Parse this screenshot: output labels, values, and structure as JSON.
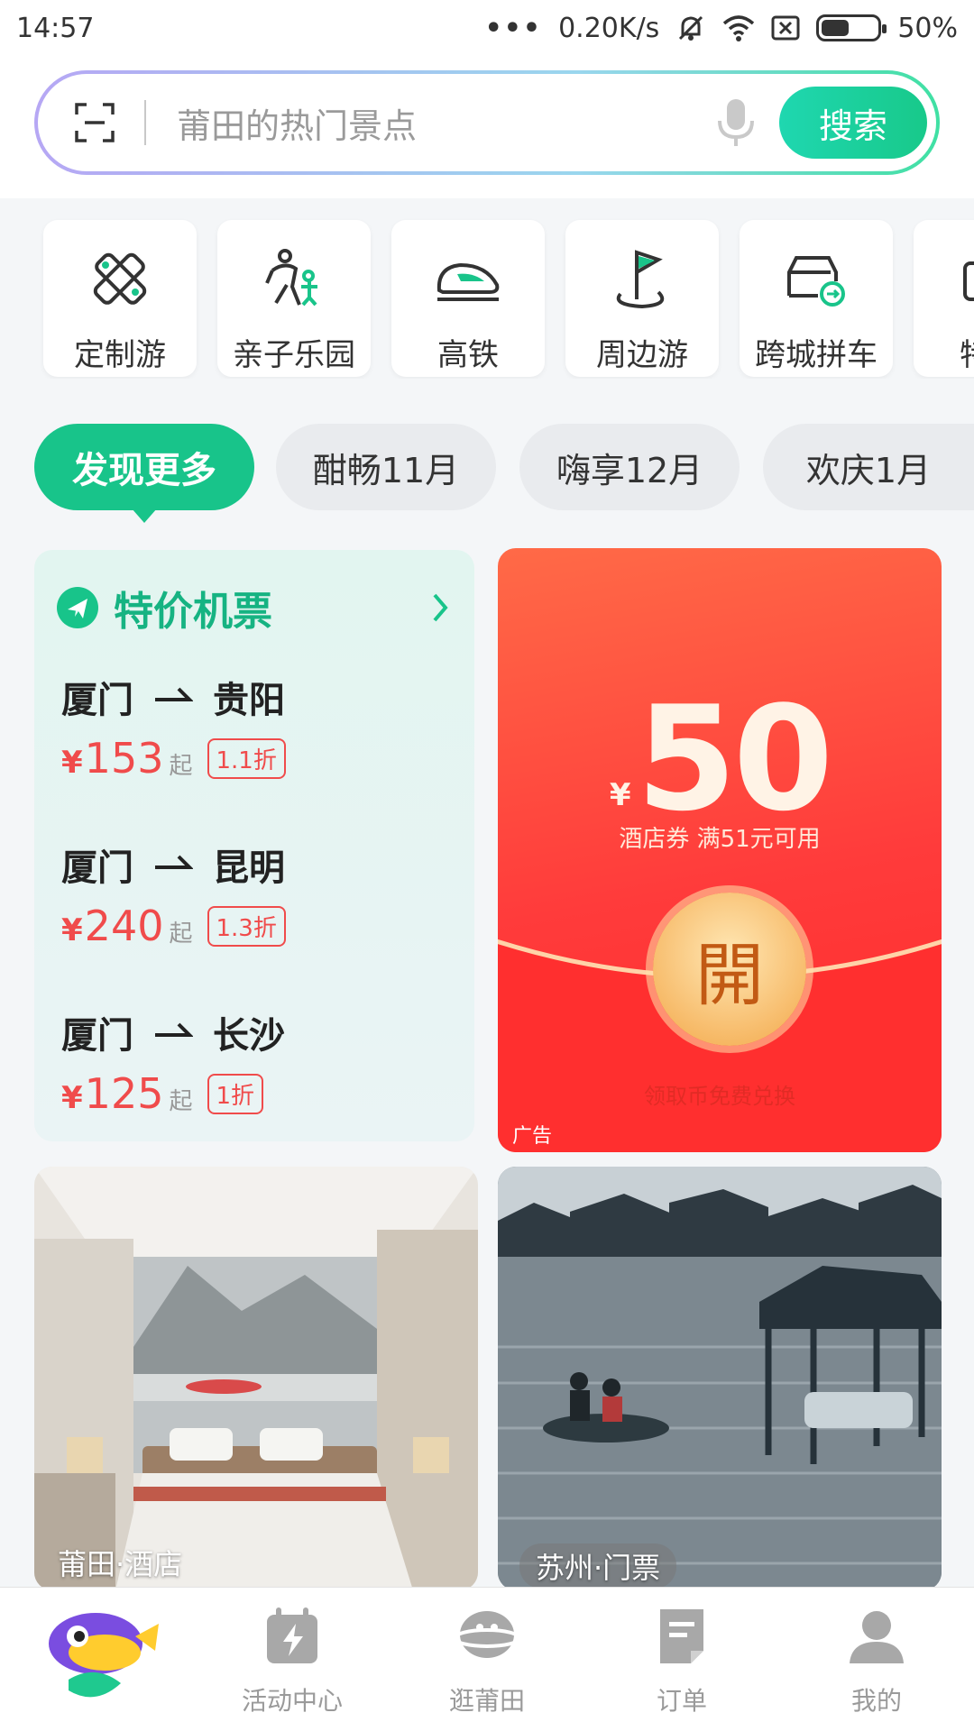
{
  "status_bar": {
    "time": "14:57",
    "dots": "•••",
    "speed": "0.20K/s",
    "battery": "50%",
    "battery_level": 0.5
  },
  "search": {
    "placeholder": "莆田的热门景点",
    "button": "搜索"
  },
  "categories": [
    {
      "label": "定制游",
      "icon": "custom-tour-icon"
    },
    {
      "label": "亲子乐园",
      "icon": "family-park-icon"
    },
    {
      "label": "高铁",
      "icon": "train-icon"
    },
    {
      "label": "周边游",
      "icon": "nearby-trip-icon"
    },
    {
      "label": "跨城拼车",
      "icon": "carpool-icon"
    },
    {
      "label": "特价",
      "icon": "special-offer-icon"
    }
  ],
  "pills": [
    "发现更多",
    "酣畅11月",
    "嗨享12月",
    "欢庆1月"
  ],
  "flights": {
    "title": "特价机票",
    "routes": [
      {
        "from": "厦门",
        "to": "贵阳",
        "price": "153",
        "qi": "起",
        "discount": "1.1折"
      },
      {
        "from": "厦门",
        "to": "昆明",
        "price": "240",
        "qi": "起",
        "discount": "1.3折"
      },
      {
        "from": "厦门",
        "to": "长沙",
        "price": "125",
        "qi": "起",
        "discount": "1折"
      }
    ],
    "currency": "¥"
  },
  "ad": {
    "currency": "¥",
    "amount": "50",
    "desc": "酒店券 满51元可用",
    "open": "開",
    "faded": "领取币免费兑换",
    "tag": "广告"
  },
  "photos": [
    {
      "label": "莆田·酒店"
    },
    {
      "label": "苏州·门票"
    }
  ],
  "nav": [
    {
      "label": "",
      "icon": "home-mascot-icon"
    },
    {
      "label": "活动中心",
      "icon": "activity-center-icon"
    },
    {
      "label": "逛莆田",
      "icon": "explore-city-icon"
    },
    {
      "label": "订单",
      "icon": "orders-icon"
    },
    {
      "label": "我的",
      "icon": "profile-icon"
    }
  ],
  "colors": {
    "brand_green": "#18c48a",
    "price_red": "#f04b4b"
  }
}
